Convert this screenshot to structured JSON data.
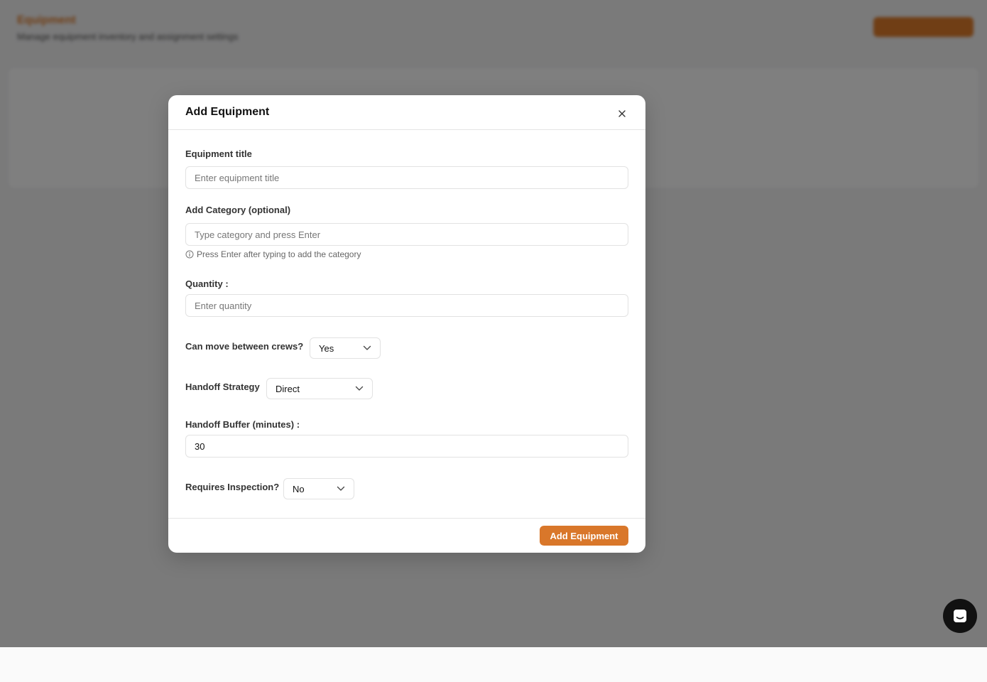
{
  "background": {
    "title": "Equipment",
    "subtitle": "Manage equipment inventory and assignment settings"
  },
  "modal": {
    "title": "Add Equipment",
    "fields": {
      "title": {
        "label": "Equipment title",
        "placeholder": "Enter equipment title",
        "value": ""
      },
      "category": {
        "label": "Add Category (optional)",
        "placeholder": "Type category and press Enter",
        "hint": "Press Enter after typing to add the category"
      },
      "quantity": {
        "label": "Quantity :",
        "placeholder": "Enter quantity"
      },
      "move_between_crews": {
        "label": "Can move between crews?",
        "selected": "Yes"
      },
      "handoff_strategy": {
        "label": "Handoff Strategy",
        "selected": "Direct"
      },
      "handoff_buffer": {
        "label": "Handoff Buffer (minutes) :",
        "value": "30"
      },
      "requires_inspection": {
        "label": "Requires Inspection?",
        "selected": "No"
      }
    },
    "submit_label": "Add Equipment"
  },
  "icons": {
    "close": "close-icon",
    "info": "info-icon",
    "chevron": "chevron-down-icon",
    "chat": "chat-icon"
  },
  "colors": {
    "accent": "#d9772a",
    "overlay": "rgba(0,0,0,0.5)"
  }
}
